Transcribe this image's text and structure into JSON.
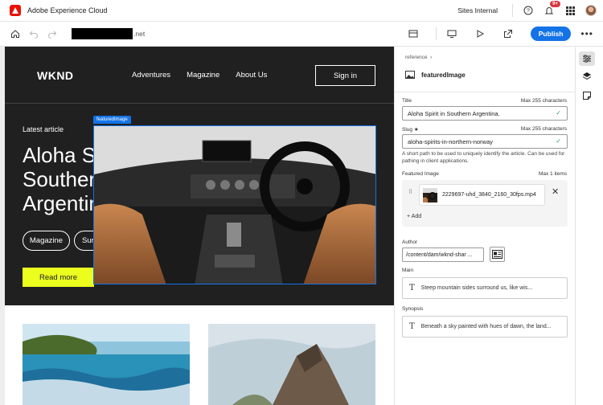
{
  "app": {
    "title": "Adobe Experience Cloud",
    "org": "Sites Internal",
    "notifications": "9+"
  },
  "toolbar": {
    "url_suffix": ".net",
    "publish_label": "Publish",
    "more": "•••"
  },
  "site": {
    "logo": "WKND",
    "nav": [
      "Adventures",
      "Magazine",
      "About Us"
    ],
    "signin": "Sign in",
    "latest_label": "Latest article",
    "headline": "Aloha Spirit in Southern Argentina.",
    "tags": [
      "Magazine",
      "Surfing"
    ],
    "read_more": "Read more",
    "featured_label": "featuredImage"
  },
  "panel": {
    "breadcrumb": "reference",
    "component": "featuredImage",
    "title_label": "Title",
    "title_hint": "Max 255 characters",
    "title_value": "Aloha Spirit in Southern Argentina.",
    "slug_label": "Slug ★",
    "slug_hint": "Max 255 characters",
    "slug_value": "aloha-spirits-in-northern-norway",
    "slug_help": "A short path to be used to uniquely identify the article. Can be used for pathing in client applications.",
    "featured_label": "Featured Image",
    "featured_hint": "Max 1 items",
    "asset_name": "2229697-uhd_3840_2160_30fps.mp4",
    "add_label": "+ Add",
    "author_label": "Author",
    "author_value": "/content/dam/wknd-shar ...",
    "main_label": "Main",
    "main_value": "Steep mountain sides surround us, like wis...",
    "synopsis_label": "Synopsis",
    "synopsis_value": "Beneath a sky painted with hues of dawn, the land..."
  },
  "colors": {
    "accent": "#1473e6",
    "brand": "#eb1000",
    "cta": "#ebfe1e",
    "header_bg": "#202020"
  },
  "icons": [
    "adobe-logo-icon",
    "help-icon",
    "bell-icon",
    "apps-grid-icon",
    "home-icon",
    "undo-icon",
    "redo-icon",
    "layout-icon",
    "desktop-icon",
    "play-icon",
    "open-icon",
    "properties-icon",
    "layers-icon",
    "notes-icon"
  ]
}
